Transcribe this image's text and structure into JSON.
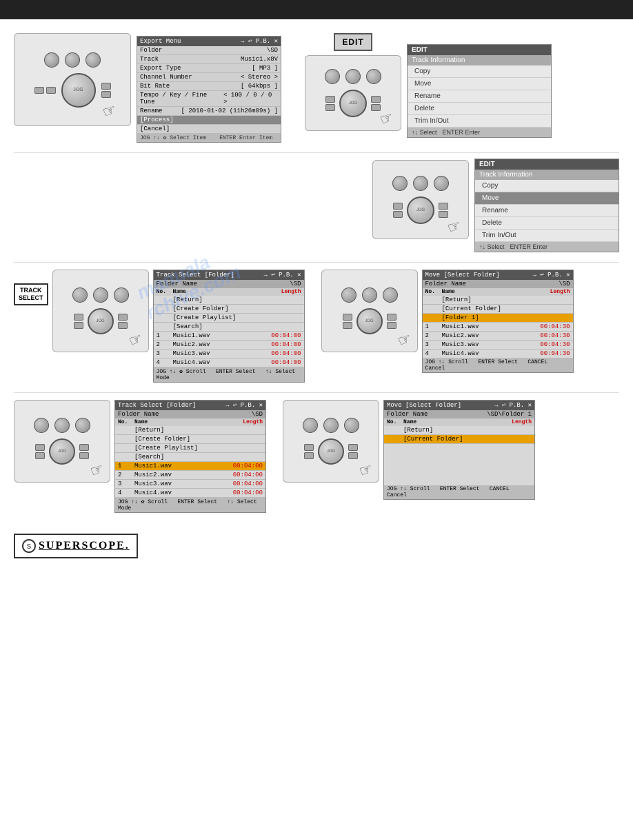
{
  "topBar": {
    "color": "#222"
  },
  "watermark": "manualarchi ve.com",
  "sections": {
    "section1": {
      "exportMenu": {
        "title": "Export Menu",
        "arrows": "→  ↩  P.B.  ✕",
        "rows": [
          {
            "label": "Folder",
            "value": "\\SD"
          },
          {
            "label": "Track",
            "value": "Music1.x8V"
          },
          {
            "label": "Export Type",
            "value": "[ MP3 ]"
          },
          {
            "label": "Channel Number",
            "value": "< Stereo >"
          },
          {
            "label": "Bit Rate",
            "value": "[ 64kbps ]"
          },
          {
            "label": "Tempo / Key / Fine Tune",
            "value": "< 100 / 0 / 0 >"
          },
          {
            "label": "Rename",
            "value": "[ 2010-01-02 (11h26m09s) ]"
          }
        ],
        "process": "[Process]",
        "cancel": "[Cancel]",
        "footer": "JOG ↑↓ ✿ Select Item    ENTER Enter Item"
      },
      "editMenu1": {
        "title": "EDIT",
        "subtitle": "Track Information",
        "items": [
          "Copy",
          "Move",
          "Rename",
          "Delete",
          "Trim In/Out"
        ],
        "footer": "↑↓ Select    ENTER Enter",
        "highlighted": ""
      }
    },
    "section2": {
      "editMenu2": {
        "title": "EDIT",
        "subtitle": "Track Information",
        "items": [
          "Copy",
          "Move",
          "Rename",
          "Delete",
          "Trim In/Out"
        ],
        "footer": "↑↓ Select    ENTER Enter",
        "highlighted": "Move"
      }
    },
    "section3": {
      "trackSelectPanel": {
        "title": "Track Select [Folder]",
        "arrows": "→  ↩  P.B.  ✕",
        "folderLabel": "Folder Name",
        "folderValue": "\\SD",
        "cols": {
          "no": "No.",
          "name": "Name",
          "length": "Length"
        },
        "rows": [
          {
            "no": "",
            "name": "[Return]",
            "length": ""
          },
          {
            "no": "",
            "name": "[Create Folder]",
            "length": ""
          },
          {
            "no": "",
            "name": "[Create Playlist]",
            "length": ""
          },
          {
            "no": "",
            "name": "[Search]",
            "length": ""
          },
          {
            "no": "1",
            "name": "Music1.wav",
            "length": "00:04:00"
          },
          {
            "no": "2",
            "name": "Music2.wav",
            "length": "00:04:00"
          },
          {
            "no": "3",
            "name": "Music3.wav",
            "length": "00:04:00"
          },
          {
            "no": "4",
            "name": "Music4.wav",
            "length": "00:04:00"
          }
        ],
        "footer": "JOG ↑↓ ✿ Scroll    ENTER Select    ↑↓ Select Mode"
      },
      "movePanel1": {
        "title": "Move [Select Folder]",
        "arrows": "→  ↩  P.B.  ✕",
        "folderLabel": "Folder Name",
        "folderValue": "\\SD",
        "cols": {
          "no": "No.",
          "name": "Name",
          "length": "Length"
        },
        "rows": [
          {
            "no": "",
            "name": "[Return]",
            "length": "",
            "hl": false
          },
          {
            "no": "",
            "name": "[Current Folder]",
            "length": "",
            "hl": false
          },
          {
            "no": "",
            "name": "[Folder 1]",
            "length": "",
            "hl": true
          },
          {
            "no": "1",
            "name": "Music1.wav",
            "length": "00:04:30",
            "hl": false
          },
          {
            "no": "2",
            "name": "Music2.wav",
            "length": "00:04:30",
            "hl": false
          },
          {
            "no": "3",
            "name": "Music3.wav",
            "length": "00:04:30",
            "hl": false
          },
          {
            "no": "4",
            "name": "Music4.wav",
            "length": "00:04:30",
            "hl": false
          }
        ],
        "footer": "JOG ↑↓ Scroll    ENTER Select    CANCEL Cancel"
      }
    },
    "section4": {
      "trackSelectPanel2": {
        "title": "Track Select [Folder]",
        "arrows": "→  ↩  P.B.  ✕",
        "folderLabel": "Folder Name",
        "folderValue": "\\SD",
        "cols": {
          "no": "No.",
          "name": "Name",
          "length": "Length"
        },
        "rows": [
          {
            "no": "",
            "name": "[Return]",
            "length": "",
            "hl": false
          },
          {
            "no": "",
            "name": "[Create Folder]",
            "length": "",
            "hl": false
          },
          {
            "no": "",
            "name": "[Create Playlist]",
            "length": "",
            "hl": false
          },
          {
            "no": "",
            "name": "[Search]",
            "length": "",
            "hl": false
          },
          {
            "no": "1",
            "name": "Music1.wav",
            "length": "00:04:00",
            "hl": true
          },
          {
            "no": "2",
            "name": "Music2.wav",
            "length": "00:04:00",
            "hl": false
          },
          {
            "no": "3",
            "name": "Music3.wav",
            "length": "00:04:00",
            "hl": false
          },
          {
            "no": "4",
            "name": "Music4.wav",
            "length": "00:04:00",
            "hl": false
          }
        ],
        "footer": "JOG ↑↓ ✿ Scroll    ENTER Select    ↑↓ Select Mode"
      },
      "movePanel2": {
        "title": "Move [Select Folder]",
        "arrows": "→  ↩  P.B.  ✕",
        "folderLabel": "Folder Name",
        "folderValue": "\\SD\\Folder 1",
        "cols": {
          "no": "No.",
          "name": "Name",
          "length": "Length"
        },
        "rows": [
          {
            "no": "",
            "name": "[Return]",
            "length": "",
            "hl": false
          },
          {
            "no": "",
            "name": "[Current Folder]",
            "length": "",
            "hl": true
          }
        ],
        "footer": "JOG ↑↓ Scroll    ENTER Select    CANCEL Cancel"
      }
    }
  },
  "trackSelectBadge": "TRACK\nSELECT",
  "logo": "SUPERSCOPE.",
  "editButton": "EDIT"
}
